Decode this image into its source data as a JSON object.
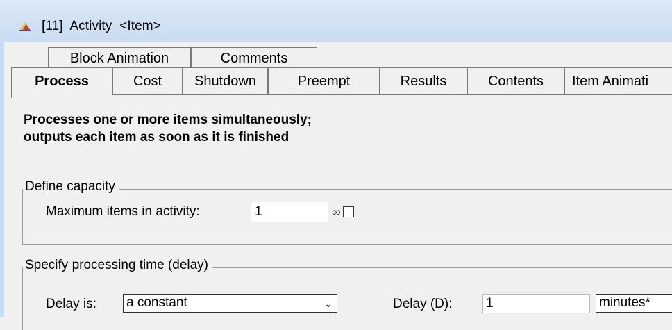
{
  "window": {
    "title": "[11]  Activity  <Item>",
    "icon": "extendsim-block-icon"
  },
  "tabs": {
    "row1": [
      {
        "label": "Block Animation"
      },
      {
        "label": "Comments"
      }
    ],
    "row2": [
      {
        "label": "Process",
        "active": true
      },
      {
        "label": "Cost"
      },
      {
        "label": "Shutdown"
      },
      {
        "label": "Preempt"
      },
      {
        "label": "Results"
      },
      {
        "label": "Contents"
      },
      {
        "label": "Item Animati"
      }
    ]
  },
  "description": {
    "line1": "Processes one or more items simultaneously;",
    "line2": "outputs each item as soon as it is finished"
  },
  "capacity": {
    "legend": "Define capacity",
    "max_label": "Maximum items in activity:",
    "max_value": "1",
    "infinity_symbol": "∞",
    "infinite_checked": false
  },
  "delay": {
    "legend": "Specify processing time (delay)",
    "delay_is_label": "Delay is:",
    "delay_is_value": "a constant",
    "delay_d_label": "Delay (D):",
    "delay_d_value": "1",
    "units_value": "minutes*"
  },
  "colors": {
    "titlebar": "#c9dcf2",
    "background": "#f0f0f0",
    "border": "#7a7a7a"
  }
}
